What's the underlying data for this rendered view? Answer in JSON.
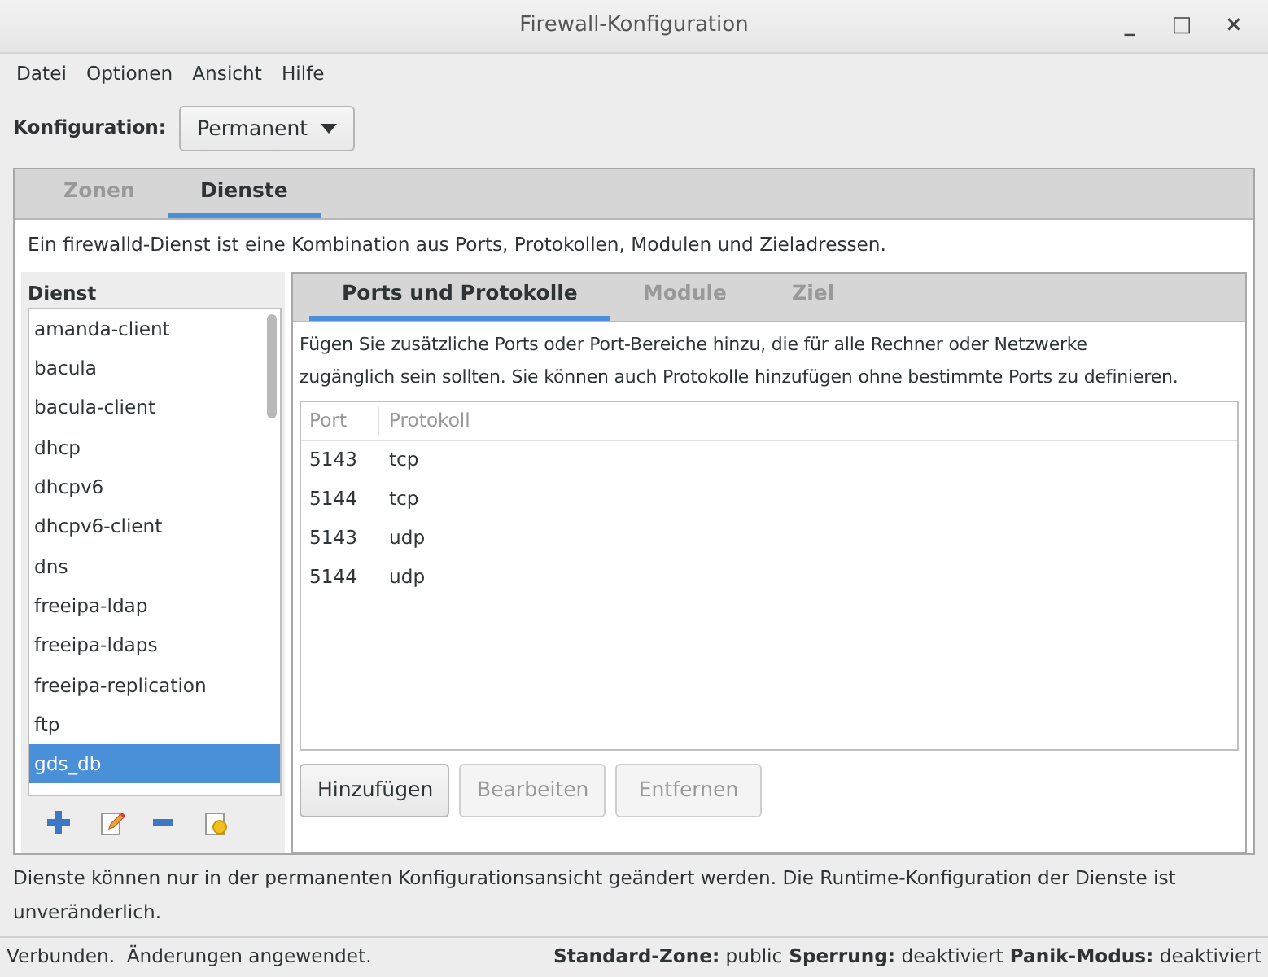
{
  "window": {
    "title": "Firewall-Konfiguration",
    "controls": [
      "_",
      "□",
      "×"
    ]
  },
  "menu": [
    "Datei",
    "Optionen",
    "Ansicht",
    "Hilfe"
  ],
  "configuration": {
    "label": "Konfiguration:",
    "value": "Permanent"
  },
  "tabs": [
    {
      "label": "Zonen",
      "selected": false
    },
    {
      "label": "Dienste",
      "selected": true
    }
  ],
  "description": "Ein firewalld-Dienst ist eine Kombination aus Ports, Protokollen, Modulen und Zieladressen.",
  "services": {
    "heading": "Dienst",
    "items": [
      {
        "label": "amanda-client",
        "selected": false
      },
      {
        "label": "bacula",
        "selected": false
      },
      {
        "label": "bacula-client",
        "selected": false
      },
      {
        "label": "dhcp",
        "selected": false
      },
      {
        "label": "dhcpv6",
        "selected": false
      },
      {
        "label": "dhcpv6-client",
        "selected": false
      },
      {
        "label": "dns",
        "selected": false
      },
      {
        "label": "freeipa-ldap",
        "selected": false
      },
      {
        "label": "freeipa-ldaps",
        "selected": false
      },
      {
        "label": "freeipa-replication",
        "selected": false
      },
      {
        "label": "ftp",
        "selected": false
      },
      {
        "label": "gds_db",
        "selected": true
      }
    ]
  },
  "subtabs": [
    {
      "label": "Ports und Protokolle",
      "selected": true
    },
    {
      "label": "Module",
      "selected": false
    },
    {
      "label": "Ziel",
      "selected": false
    }
  ],
  "ports_hint": "Fügen Sie zusätzliche Ports oder Port-Bereiche hinzu, die für alle Rechner oder Netzwerke zugänglich sein sollten. Sie können auch Protokolle hinzufügen ohne bestimmte Ports zu definieren.",
  "table": {
    "columns": [
      "Port",
      "Protokoll"
    ],
    "rows": [
      [
        "5143",
        "tcp"
      ],
      [
        "5144",
        "tcp"
      ],
      [
        "5143",
        "udp"
      ],
      [
        "5144",
        "udp"
      ]
    ]
  },
  "buttons": [
    {
      "label": "Hinzufügen",
      "disabled": false
    },
    {
      "label": "Bearbeiten",
      "disabled": true
    },
    {
      "label": "Entfernen",
      "disabled": true
    }
  ],
  "note": "Dienste können nur in der permanenten Konfigurationsansicht geändert werden. Die Runtime-Konfiguration der Dienste ist unveränderlich.",
  "status_bar": {
    "message": "Verbunden.  Änderungen angewendet.",
    "fields": [
      {
        "label": "Standard-Zone:",
        "value": "public"
      },
      {
        "label": "Sperrung:",
        "value": "deaktiviert"
      },
      {
        "label": "Panik-Modus:",
        "value": "deaktiviert"
      }
    ]
  }
}
